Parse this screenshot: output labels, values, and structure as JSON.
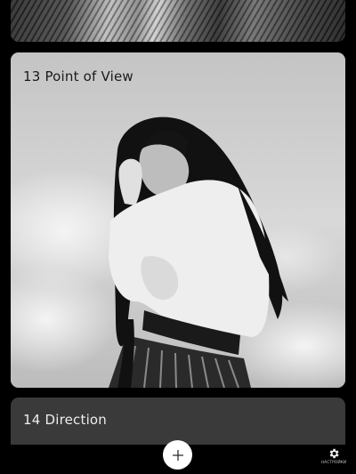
{
  "cards": [
    {
      "label": ""
    },
    {
      "label": "13 Point of View"
    },
    {
      "label": "14 Direction"
    }
  ],
  "toolbar": {
    "add_icon": "plus-icon",
    "settings_icon": "gear-icon",
    "settings_label": "НАСТРОЙКИ"
  },
  "colors": {
    "background": "#000000",
    "add_button": "#ffffff",
    "card_bottom": "#3a3a3a"
  }
}
